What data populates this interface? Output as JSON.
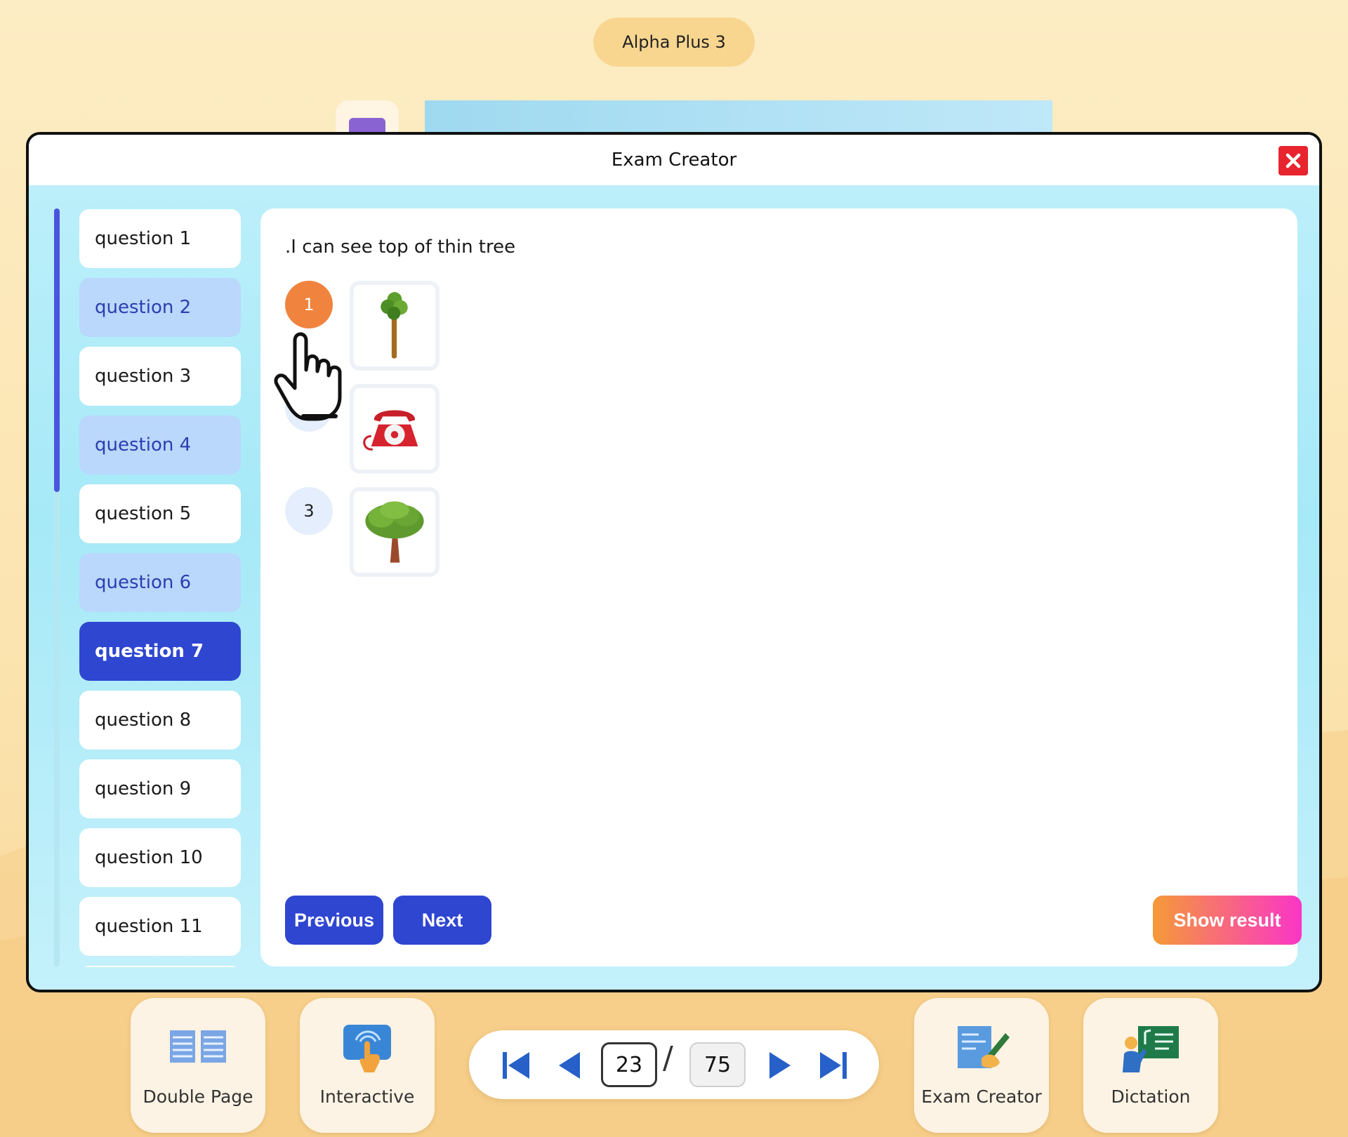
{
  "book": {
    "title": "Alpha Plus 3"
  },
  "modal": {
    "title": "Exam Creator",
    "close_icon": "close-icon"
  },
  "questions": [
    {
      "label": "question 1"
    },
    {
      "label": "question 2"
    },
    {
      "label": "question 3"
    },
    {
      "label": "question 4"
    },
    {
      "label": "question 5"
    },
    {
      "label": "question 6"
    },
    {
      "label": "question 7"
    },
    {
      "label": "question 8"
    },
    {
      "label": "question 9"
    },
    {
      "label": "question 10"
    },
    {
      "label": "question 11"
    }
  ],
  "active_question": "question 7",
  "question": {
    "prompt": ".I can see top of thin tree",
    "options": [
      {
        "number": "1",
        "image": "thin-tree-icon",
        "selected": true
      },
      {
        "number": "2",
        "image": "telephone-icon",
        "selected": false
      },
      {
        "number": "3",
        "image": "broad-tree-icon",
        "selected": false
      }
    ]
  },
  "actions": {
    "previous": "Previous",
    "next": "Next",
    "show_result": "Show result"
  },
  "toolbar": {
    "double_page": "Double Page",
    "interactive": "Interactive",
    "exam_creator": "Exam Creator",
    "dictation": "Dictation"
  },
  "pager": {
    "current": "23",
    "separator": "/",
    "total": "75"
  },
  "colors": {
    "primary": "#2f46d0",
    "selected_option": "#f0843e",
    "close": "#e8242f",
    "result_gradient_start": "#f59a38",
    "result_gradient_end": "#fb35c7"
  }
}
